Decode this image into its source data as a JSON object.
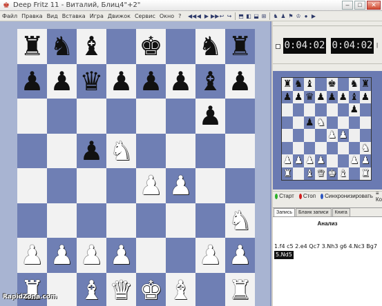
{
  "window": {
    "title": "Deep Fritz 11 - Виталий, Блиц4\"+2\"",
    "buttons": [
      "–",
      "□",
      "✕"
    ]
  },
  "menu": [
    "Файл",
    "Правка",
    "Вид",
    "Вставка",
    "Игра",
    "Движок",
    "Сервис",
    "Окно",
    "?"
  ],
  "toolbar": {
    "icons": [
      "◀◀",
      "◀",
      "▶",
      "▶▶",
      "↩",
      "↪",
      "⬒",
      "◧",
      "⬓",
      "⊞",
      "♞",
      "♟",
      "⚑",
      "♔",
      "●",
      "▶"
    ]
  },
  "board": {
    "ranks": [
      [
        "br",
        "bn",
        "bb",
        "",
        "bk",
        "",
        "bn",
        "br"
      ],
      [
        "bp",
        "bp",
        "bq",
        "bp",
        "bp",
        "bp",
        "bb",
        "bp"
      ],
      [
        "",
        "",
        "",
        "",
        "",
        "",
        "bp",
        ""
      ],
      [
        "",
        "",
        "bp",
        "wn",
        "",
        "",
        "",
        ""
      ],
      [
        "",
        "",
        "",
        "",
        "wp",
        "wp",
        "",
        ""
      ],
      [
        "",
        "",
        "",
        "",
        "",
        "",
        "",
        "wn"
      ],
      [
        "wp",
        "wp",
        "wp",
        "wp",
        "",
        "",
        "wp",
        "wp"
      ],
      [
        "wr",
        "",
        "wb",
        "wq",
        "wk",
        "wb",
        "",
        "wr"
      ]
    ]
  },
  "clocks": {
    "white": "0:04:02",
    "black": "0:04:02",
    "side_mark": "|"
  },
  "engine_bar": {
    "start": "Старт",
    "stop": "Стоп",
    "sync": "Синхронизировать",
    "extra": "≡ Ко"
  },
  "notation": {
    "tabs": [
      "Запись",
      "Бланк записи",
      "Книга"
    ],
    "active_tab": 0,
    "title": "Анализ",
    "moves": "1.f4  c5  2.e4  Qc7  3.Nh3  g6  4.Nc3  Bg7",
    "current_move": "5.Nd5"
  },
  "watermark": "RapidZona.com"
}
